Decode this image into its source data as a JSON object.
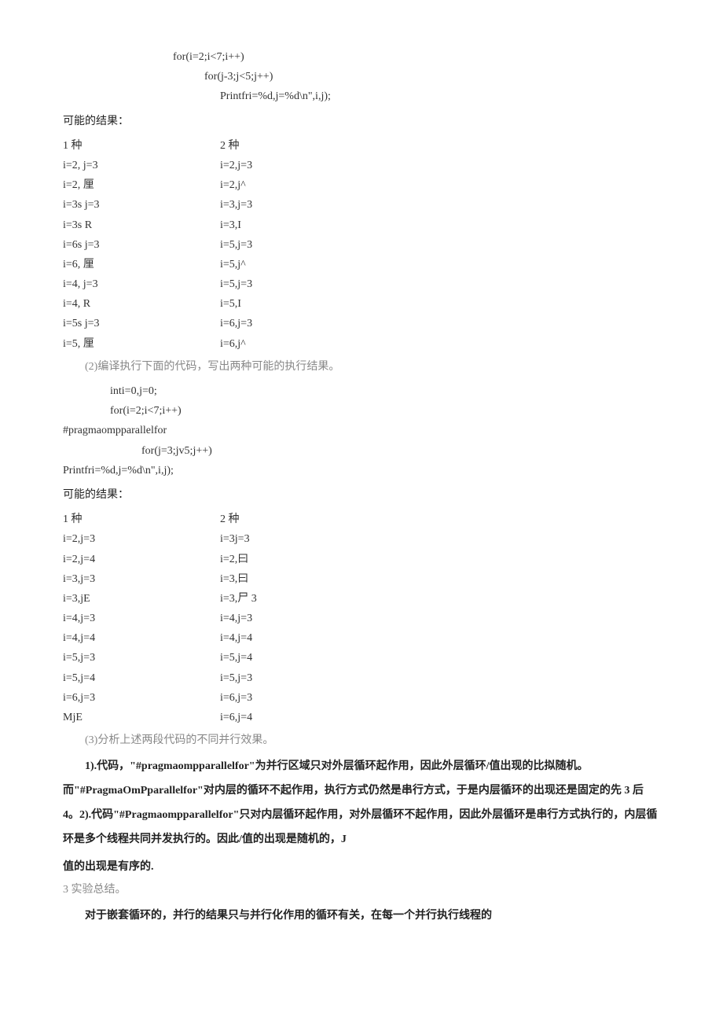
{
  "code1": {
    "l1": "for(i=2;i<7;i++)",
    "l2": "for(j-3;j<5;j++)",
    "l3": "Printfri=%d,j=%d\\n\",i,j);"
  },
  "label_possible": "可能的结果：",
  "tab1": {
    "h1": "1 种",
    "h2": "2 种",
    "rowsA": [
      "i=2,  j=3",
      "i=2,  厘",
      "i=3s  j=3",
      "i=3s  R",
      "i=6s  j=3",
      "i=6,  厘",
      "i=4,  j=3",
      "i=4,  R",
      "i=5s  j=3",
      "i=5,  厘"
    ],
    "rowsB": [
      "i=2,j=3",
      "i=2,j^",
      "i=3,j=3",
      "i=3,I",
      "i=5,j=3",
      "i=5,j^",
      "i=5,j=3",
      "i=5,I",
      "i=6,j=3",
      "i=6,j^"
    ]
  },
  "q2": "(2)编译执行下面的代码，写出两种可能的执行结果。",
  "code2": {
    "l1": "inti=0,j=0;",
    "l2": "for(i=2;i<7;i++)",
    "l3": "#pragmaompparallelfor",
    "l4": "for(j=3;jv5;j++)",
    "l5": "Printfri=%d,j=%d\\n\",i,j);"
  },
  "tab2": {
    "h1": "1 种",
    "h2": "2 种",
    "rowsA": [
      "i=2,j=3",
      "i=2,j=4",
      "i=3,j=3",
      "i=3,jE",
      "i=4,j=3",
      "i=4,j=4",
      "i=5,j=3",
      "i=5,j=4",
      "i=6,j=3",
      "MjE"
    ],
    "rowsB": [
      "i=3j=3",
      "i=2,曰",
      "i=3,曰",
      "i=3,尸 3",
      "i=4,j=3",
      "i=4,j=4",
      "i=5,j=4",
      "i=5,j=3",
      "i=6,j=3",
      "i=6,j=4"
    ]
  },
  "q3": "(3)分析上述两段代码的不同并行效果。",
  "analysis": "1).代码，\"#pragmaompparallelfor\"为并行区域只对外层循环起作用，因此外层循环/值出现的比拟随机。而\"#PragmaOmPparallelfor\"对内层的循环不起作用，执行方式仍然是串行方式，于是内层循环的出现还是固定的先 3 后 4。2).代码\"#Pragmaompparallelfor\"只对内层循环起作用，对外层循环不起作用，因此外层循环是串行方式执行的，内层循环是多个线程共同并发执行的。因此/值的出现是随机的，J",
  "analysis_tail": "值的出现是有序的.",
  "summary_head": "3 实验总结。",
  "summary": "对于嵌套循环的，并行的结果只与并行化作用的循环有关，在每一个并行执行线程的"
}
